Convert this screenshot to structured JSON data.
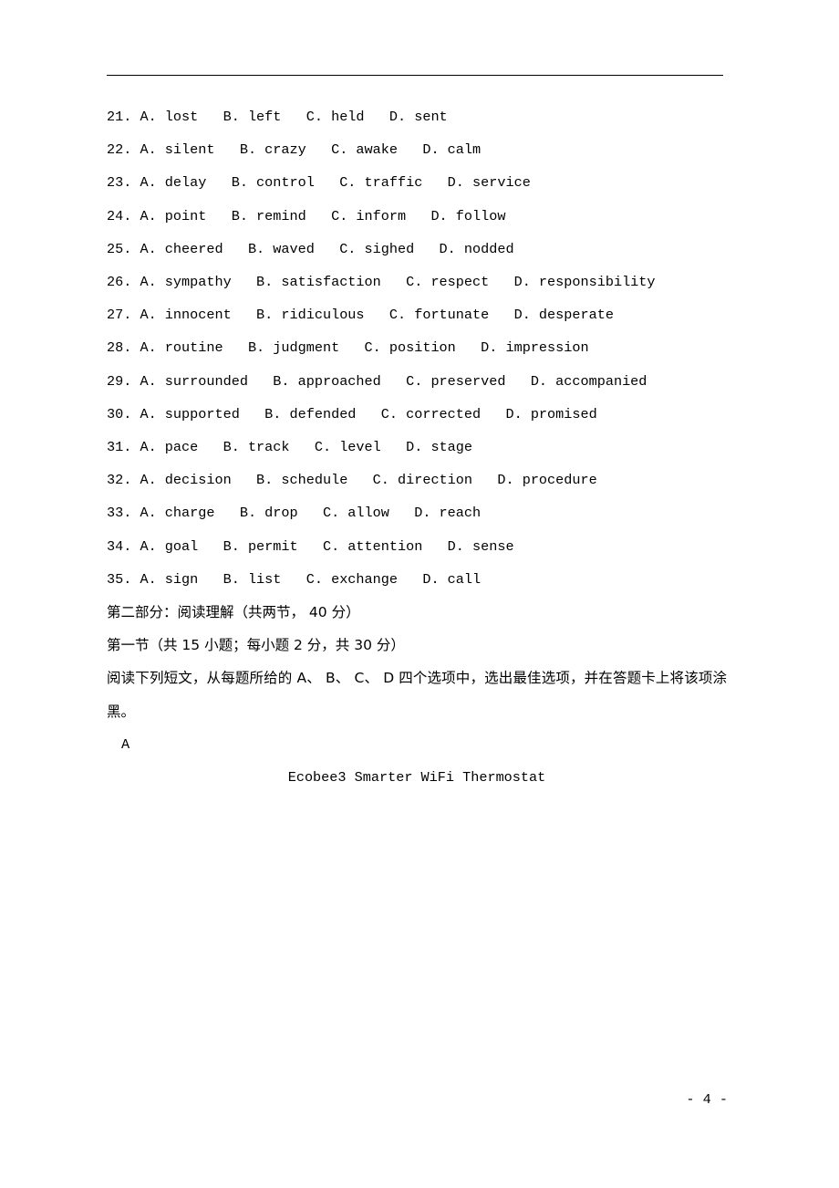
{
  "document": {
    "questions": [
      "21. A. lost   B. left   C. held   D. sent",
      "22. A. silent   B. crazy   C. awake   D. calm",
      "23. A. delay   B. control   C. traffic   D. service",
      "24. A. point   B. remind   C. inform   D. follow",
      "25. A. cheered   B. waved   C. sighed   D. nodded",
      "26. A. sympathy   B. satisfaction   C. respect   D. responsibility",
      "27. A. innocent   B. ridiculous   C. fortunate   D. desperate",
      "28. A. routine   B. judgment   C. position   D. impression",
      "29. A. surrounded   B. approached   C. preserved   D. accompanied",
      "30. A. supported   B. defended   C. corrected   D. promised",
      "31. A. pace   B. track   C. level   D. stage",
      "32. A. decision   B. schedule   C. direction   D. procedure",
      "33. A. charge   B. drop   C. allow   D. reach",
      "34. A. goal   B. permit   C. attention   D. sense",
      "35. A. sign   B. list   C. exchange   D. call"
    ],
    "part_two_heading": "第二部分：阅读理解（共两节， 40 分）",
    "section_one_heading": "第一节（共 15 小题；每小题 2 分，共 30 分）",
    "instructions": "阅读下列短文，从每题所给的 A、 B、 C、 D 四个选项中，选出最佳选项，并在答题卡上将该项涂黑。",
    "section_letter": "A",
    "passage_title": "Ecobee3 Smarter WiFi Thermostat",
    "page_number": "- 4 -"
  }
}
